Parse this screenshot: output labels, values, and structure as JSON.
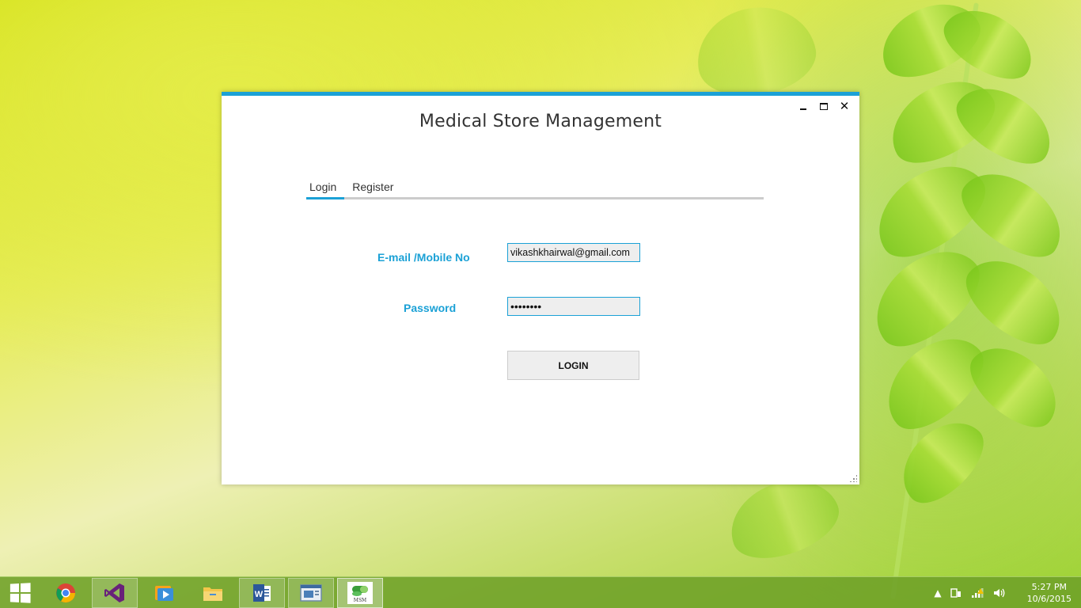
{
  "window": {
    "title": "Medical Store Management",
    "controls": {
      "minimize": "minimize-icon",
      "maximize": "maximize-icon",
      "close_glyph": "✕"
    }
  },
  "tabs": [
    {
      "label": "Login",
      "active": true
    },
    {
      "label": "Register",
      "active": false
    }
  ],
  "form": {
    "email_label": "E-mail /Mobile  No",
    "email_value": "vikashkhairwal@gmail.com",
    "password_label": "Password",
    "password_value": "12345678",
    "login_button": "LOGIN"
  },
  "colors": {
    "accent": "#1ba1d6",
    "label": "#1ba1d6",
    "field_bg": "#eeeeee"
  },
  "taskbar": {
    "apps": [
      {
        "icon": "chrome-icon",
        "state": "pinned"
      },
      {
        "icon": "visual-studio-icon",
        "state": "running"
      },
      {
        "icon": "media-player-icon",
        "state": "pinned"
      },
      {
        "icon": "file-explorer-icon",
        "state": "pinned"
      },
      {
        "icon": "word-icon",
        "state": "running"
      },
      {
        "icon": "window-app-icon",
        "state": "running"
      },
      {
        "icon": "msm-app-icon",
        "state": "active",
        "label": "MSM"
      }
    ],
    "tray": {
      "show_hidden": "▲",
      "icons": [
        "action-center-icon",
        "network-icon",
        "volume-icon"
      ]
    },
    "clock": {
      "time": "5:27 PM",
      "date": "10/6/2015"
    }
  }
}
